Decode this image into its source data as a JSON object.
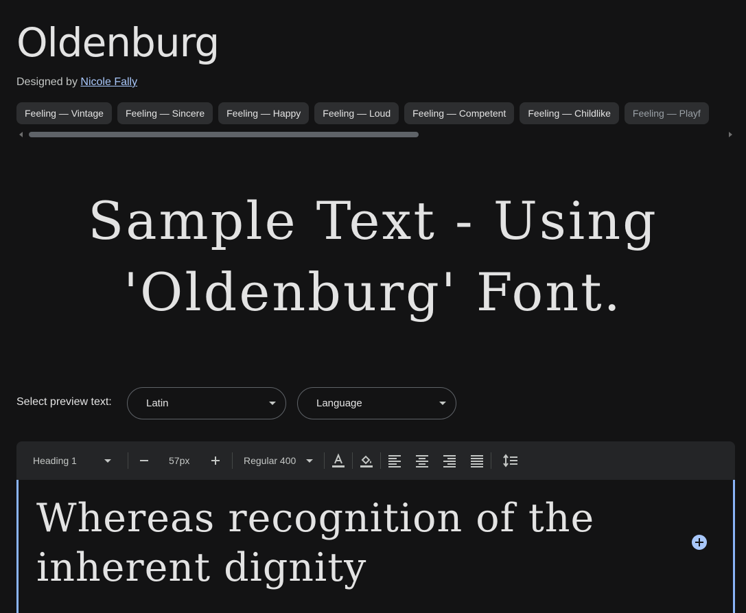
{
  "font": {
    "title": "Oldenburg",
    "designed_by_prefix": "Designed by",
    "designer_name": "Nicole Fally"
  },
  "tags": [
    "Feeling — Vintage",
    "Feeling — Sincere",
    "Feeling — Happy",
    "Feeling — Loud",
    "Feeling — Competent",
    "Feeling — Childlike",
    "Feeling — Playf"
  ],
  "hero": {
    "line1": "Sample Text - Using",
    "line2": "'Oldenburg' Font."
  },
  "preview": {
    "label": "Select preview text:",
    "script_value": "Latin",
    "language_value": "Language"
  },
  "toolbar": {
    "style_value": "Heading 1",
    "size_value": "57px",
    "weight_value": "Regular 400",
    "decrease_icon": "minus-icon",
    "increase_icon": "plus-icon",
    "text_color_icon": "text-color-icon",
    "highlight_icon": "fill-color-icon",
    "align_icons": [
      "align-left-icon",
      "align-center-icon",
      "align-right-icon",
      "align-justify-icon"
    ],
    "line_height_icon": "line-spacing-icon"
  },
  "editor": {
    "text": "Whereas recognition of the inherent dignity",
    "add_icon": "add-circle-icon",
    "accent_color": "#8ab4f8"
  }
}
